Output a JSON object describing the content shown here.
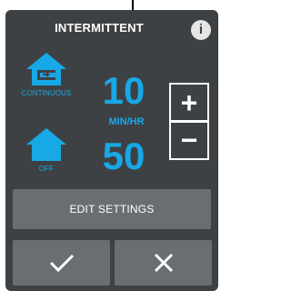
{
  "header": {
    "title": "INTERMITTENT",
    "info_icon": "info-icon",
    "info_glyph": "i"
  },
  "modes": {
    "continuous": {
      "label": "CONTINUOUS",
      "icon": "continuous-home-icon"
    },
    "off": {
      "label": "OFF",
      "icon": "off-home-icon"
    }
  },
  "rate": {
    "value": "10",
    "unit": "MIN/HR"
  },
  "off_value": {
    "value": "50"
  },
  "steppers": {
    "plus_glyph": "+",
    "minus_glyph": "−"
  },
  "actions": {
    "edit_label": "EDIT SETTINGS",
    "confirm_icon": "checkmark-icon",
    "cancel_icon": "close-icon"
  },
  "colors": {
    "accent": "#18a8e6",
    "panel": "#3e4143",
    "button": "#6b6e70"
  }
}
